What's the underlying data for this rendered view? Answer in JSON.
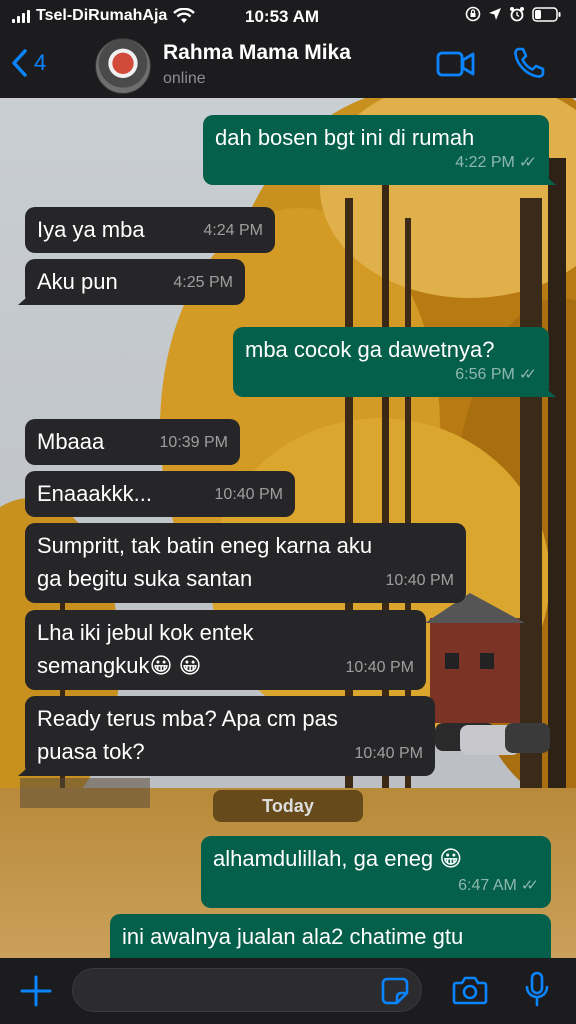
{
  "status_bar": {
    "carrier": "Tsel-DiRumahAja",
    "time": "10:53 AM"
  },
  "header": {
    "back_count": "4",
    "contact_name": "Rahma Mama Mika",
    "contact_status": "online"
  },
  "messages": [
    {
      "dir": "out",
      "text": "dah bosen bgt ini di rumah",
      "time": "4:22 PM",
      "read": true
    },
    {
      "dir": "in",
      "text": "Iya ya mba",
      "time": "4:24 PM"
    },
    {
      "dir": "in",
      "text": "Aku pun",
      "time": "4:25 PM"
    },
    {
      "dir": "out",
      "text": "mba cocok ga dawetnya?",
      "time": "6:56 PM",
      "read": true
    },
    {
      "dir": "in",
      "text": "Mbaaa",
      "time": "10:39 PM"
    },
    {
      "dir": "in",
      "text": "Enaaakkk...",
      "time": "10:40 PM"
    },
    {
      "dir": "in",
      "text": "Sumpritt, tak batin eneg karna aku\nga begitu suka santan",
      "time": "10:40 PM"
    },
    {
      "dir": "in",
      "text": "Lha iki jebul kok entek\nsemangkuk😀 😀",
      "time": "10:40 PM"
    },
    {
      "dir": "in",
      "text": "Ready terus mba? Apa cm pas\npuasa tok?",
      "time": "10:40 PM"
    },
    {
      "dir": "out",
      "text": "alhamdulillah, ga eneg 😀",
      "time": "6:47 AM",
      "read": true
    },
    {
      "dir": "out",
      "text": "ini awalnya jualan ala2 chatime gtu",
      "time": ""
    }
  ],
  "date_separator": "Today",
  "input": {
    "value": "",
    "placeholder": ""
  },
  "icons": {
    "back": "chevron-left-icon",
    "video": "video-camera-icon",
    "call": "phone-icon",
    "plus": "plus-icon",
    "sticker": "sticker-icon",
    "camera": "camera-icon",
    "mic": "microphone-icon"
  },
  "colors": {
    "accent": "#0a84ff",
    "outgoing_bubble": "#045f4b",
    "incoming_bubble": "#262628",
    "date_pill": "#604418"
  }
}
